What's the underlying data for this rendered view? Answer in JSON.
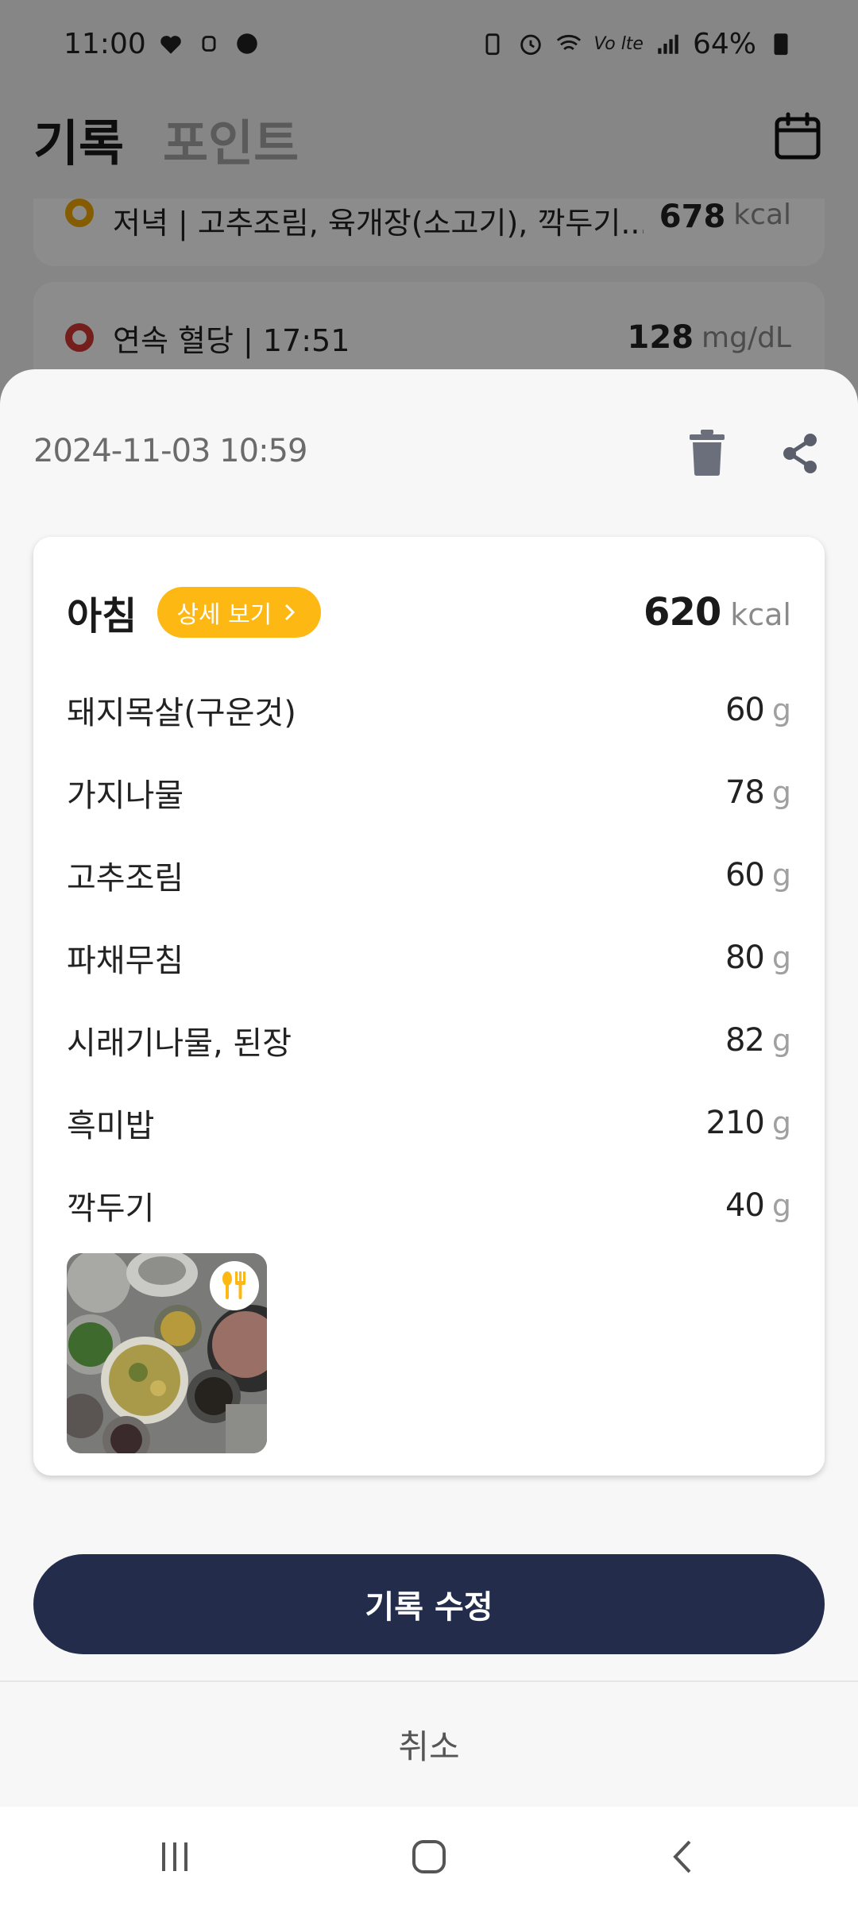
{
  "status_bar": {
    "time": "11:00",
    "battery": "64%",
    "network_label": "Vo lte"
  },
  "header": {
    "tab_active": "기록",
    "tab_inactive": "포인트"
  },
  "background_list": [
    {
      "title": "저녁 | 고추조림, 육개장(소고기), 깍두기...",
      "value": "678",
      "unit": "kcal",
      "dot_color": "#f2a900"
    },
    {
      "title": "연속 혈당 | 17:51",
      "value": "128",
      "unit": "mg/dL",
      "dot_color": "#d63a35"
    }
  ],
  "sheet": {
    "datetime": "2024-11-03 10:59",
    "meal": {
      "name": "아침",
      "detail_button": "상세 보기",
      "kcal_value": "620",
      "kcal_unit": "kcal",
      "foods": [
        {
          "name": "돼지목살(구운것)",
          "amount": "60",
          "unit": "g"
        },
        {
          "name": "가지나물",
          "amount": "78",
          "unit": "g"
        },
        {
          "name": "고추조림",
          "amount": "60",
          "unit": "g"
        },
        {
          "name": "파채무침",
          "amount": "80",
          "unit": "g"
        },
        {
          "name": "시래기나물, 된장",
          "amount": "82",
          "unit": "g"
        },
        {
          "name": "흑미밥",
          "amount": "210",
          "unit": "g"
        },
        {
          "name": "깍두기",
          "amount": "40",
          "unit": "g"
        }
      ]
    },
    "edit_button": "기록 수정",
    "cancel_button": "취소"
  },
  "colors": {
    "accent_yellow": "#fdb813",
    "primary_navy": "#232d4b"
  },
  "icons": [
    "calendar-icon",
    "trash-icon",
    "share-icon",
    "chevron-right-icon",
    "fork-spoon-icon",
    "recents-icon",
    "home-icon",
    "back-icon"
  ]
}
